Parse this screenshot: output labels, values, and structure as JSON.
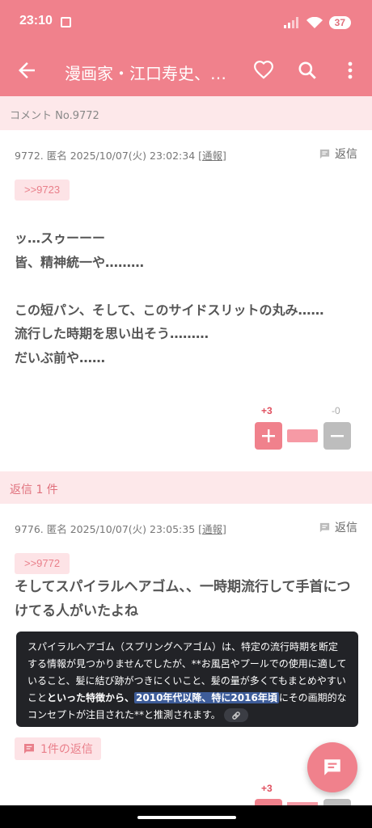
{
  "status": {
    "time": "23:10",
    "battery": "37"
  },
  "app_bar": {
    "title": "漫画家・江口寿史、…"
  },
  "comment_header": {
    "label": "コメント No.9772"
  },
  "comment": {
    "meta_prefix": "9772. 匿名 2025/10/07(火) 23:02:34 [",
    "report": "通報",
    "meta_suffix": "]",
    "reply_label": "返信",
    "anchor": ">>9723",
    "body": "ッ…スゥーーー\n皆、精神統一や………\n\nこの短パン、そして、このサイドスリットの丸み……\n流行した時期を思い出そう………\nだいぶ前や……",
    "plus_count": "+3",
    "minus_count": "-0"
  },
  "replies_header": {
    "label": "返信 1 件"
  },
  "reply": {
    "meta_prefix": "9776. 匿名 2025/10/07(火) 23:05:35 [",
    "report": "通報",
    "meta_suffix": "]",
    "reply_label": "返信",
    "anchor": ">>9772",
    "headline": "そしてスパイラルヘアゴム、、一時期流行して手首につけてる人がいたよね",
    "replies_button": "1件の返信",
    "plus_count": "+3"
  },
  "ai_popup": {
    "text_1": "スパイラルヘアゴム（スプリングヘアゴム）は、特定の流行時期を断定する情報が見つかりませんでしたが、**お風呂やプールでの使用に適していること、髪に結び跡がつきにくいこと、髪の量が多くてもまとめやすいこと",
    "text_bold": "といった特徴から、",
    "text_highlight": "2010年代以降、特に2016年頃",
    "text_2": "にその画期的なコンセプトが注目された**と推測されます。"
  },
  "colors": {
    "accent": "#f0818c",
    "band": "#fde8ea",
    "plus": "#f0818c",
    "minus": "#bdbdbd",
    "plus_text": "#e0505f"
  },
  "icons": [
    "back-arrow-icon",
    "heart-icon",
    "search-icon",
    "more-vert-icon",
    "reply-icon",
    "plus-icon",
    "minus-icon",
    "link-icon",
    "chat-icon"
  ]
}
